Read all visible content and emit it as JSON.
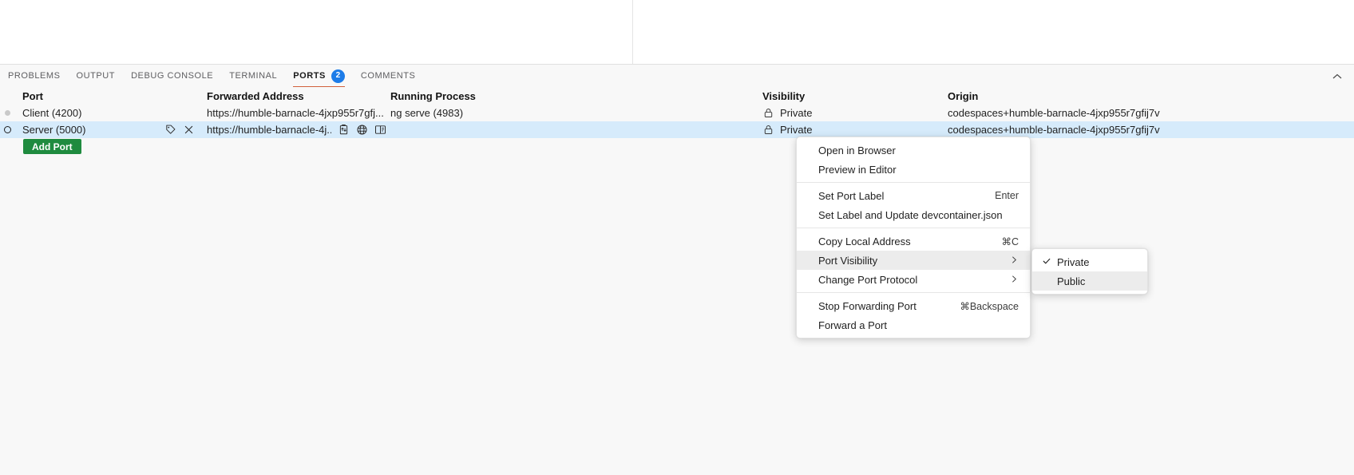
{
  "panel": {
    "tabs": [
      {
        "label": "PROBLEMS",
        "active": false,
        "badge": null
      },
      {
        "label": "OUTPUT",
        "active": false,
        "badge": null
      },
      {
        "label": "DEBUG CONSOLE",
        "active": false,
        "badge": null
      },
      {
        "label": "TERMINAL",
        "active": false,
        "badge": null
      },
      {
        "label": "PORTS",
        "active": true,
        "badge": "2"
      },
      {
        "label": "COMMENTS",
        "active": false,
        "badge": null
      }
    ],
    "collapse_icon": "chevron-up-icon",
    "accent_active_tab": "#d1603d",
    "badge_color": "#1d7ce8"
  },
  "table": {
    "headers": {
      "port": "Port",
      "forwarded_address": "Forwarded Address",
      "running_process": "Running Process",
      "visibility": "Visibility",
      "origin": "Origin"
    },
    "rows": [
      {
        "status": "idle",
        "port": "Client (4200)",
        "forwarded_address": "https://humble-barnacle-4jxp955r7gfj...",
        "running_process": "ng serve (4983)",
        "visibility": "Private",
        "visibility_icon": "lock-icon",
        "origin": "codespaces+humble-barnacle-4jxp955r7gfij7v",
        "selected": false,
        "show_row_actions": false,
        "show_address_actions": false
      },
      {
        "status": "running",
        "port": "Server (5000)",
        "forwarded_address": "https://humble-barnacle-4j...",
        "running_process": "",
        "visibility": "Private",
        "visibility_icon": "lock-icon",
        "origin": "codespaces+humble-barnacle-4jxp955r7gfij7v",
        "selected": true,
        "show_row_actions": true,
        "show_address_actions": true,
        "row_action_icons": [
          "tag-icon",
          "close-icon"
        ],
        "address_action_icons": [
          "copy-icon",
          "globe-icon",
          "preview-editor-icon"
        ]
      }
    ]
  },
  "add_port": {
    "label": "Add Port",
    "color": "#1f8b3f"
  },
  "context_menu": {
    "groups": [
      {
        "items": [
          {
            "label": "Open in Browser",
            "shortcut": "",
            "submenu": false,
            "highlight": false,
            "checked": false
          },
          {
            "label": "Preview in Editor",
            "shortcut": "",
            "submenu": false,
            "highlight": false,
            "checked": false
          }
        ]
      },
      {
        "items": [
          {
            "label": "Set Port Label",
            "shortcut": "Enter",
            "submenu": false,
            "highlight": false,
            "checked": false
          },
          {
            "label": "Set Label and Update devcontainer.json",
            "shortcut": "",
            "submenu": false,
            "highlight": false,
            "checked": false
          }
        ]
      },
      {
        "items": [
          {
            "label": "Copy Local Address",
            "shortcut": "⌘C",
            "submenu": false,
            "highlight": false,
            "checked": false
          },
          {
            "label": "Port Visibility",
            "shortcut": "",
            "submenu": true,
            "highlight": true,
            "checked": false
          },
          {
            "label": "Change Port Protocol",
            "shortcut": "",
            "submenu": true,
            "highlight": false,
            "checked": false
          }
        ]
      },
      {
        "items": [
          {
            "label": "Stop Forwarding Port",
            "shortcut": "⌘Backspace",
            "submenu": false,
            "highlight": false,
            "checked": false
          },
          {
            "label": "Forward a Port",
            "shortcut": "",
            "submenu": false,
            "highlight": false,
            "checked": false
          }
        ]
      }
    ]
  },
  "submenu": {
    "items": [
      {
        "label": "Private",
        "checked": true,
        "highlight": false
      },
      {
        "label": "Public",
        "checked": false,
        "highlight": true
      }
    ]
  }
}
